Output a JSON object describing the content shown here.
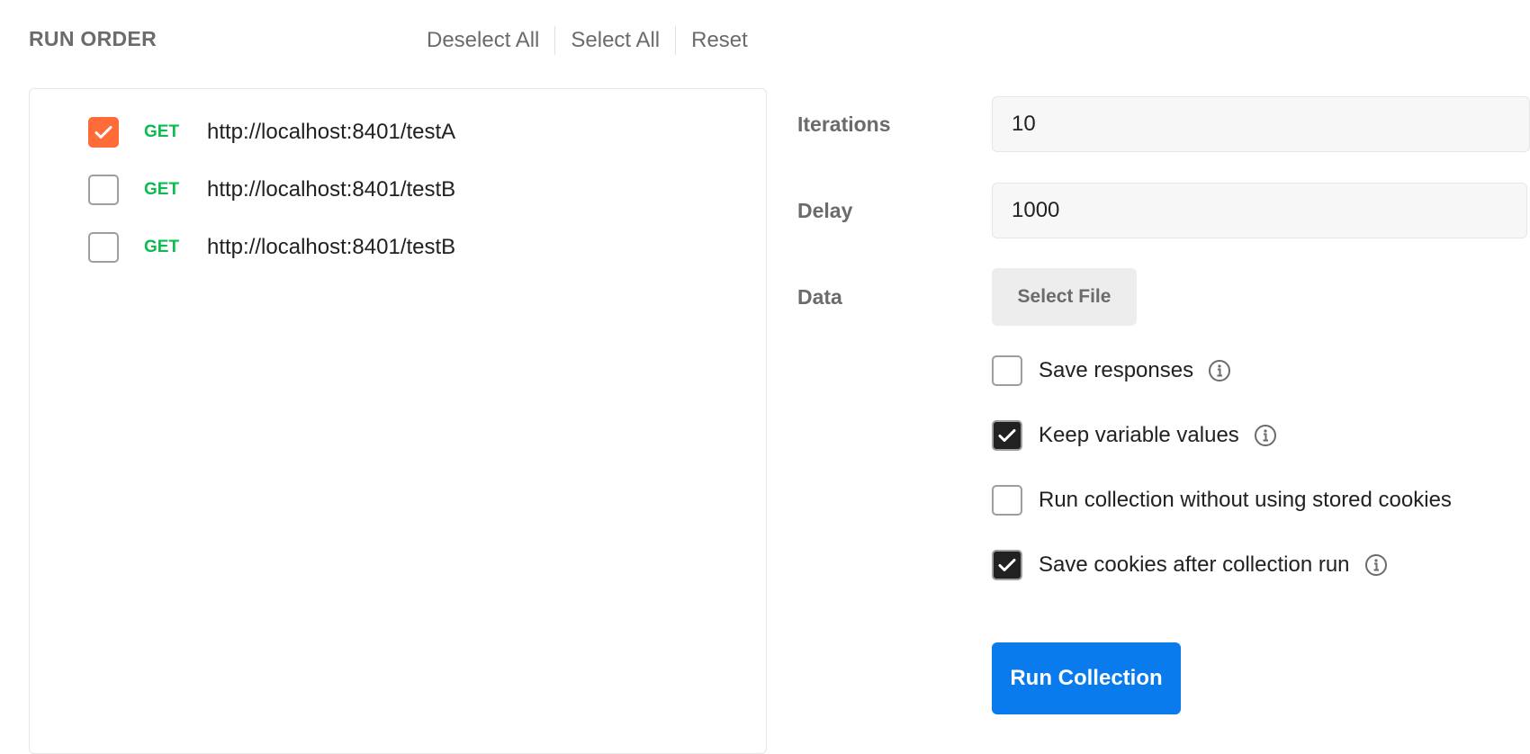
{
  "run_order": {
    "title": "RUN ORDER",
    "deselect_all": "Deselect All",
    "select_all": "Select All",
    "reset": "Reset",
    "requests": [
      {
        "method": "GET",
        "url": "http://localhost:8401/testA",
        "checked": true
      },
      {
        "method": "GET",
        "url": "http://localhost:8401/testB",
        "checked": false
      },
      {
        "method": "GET",
        "url": "http://localhost:8401/testB",
        "checked": false
      }
    ]
  },
  "settings": {
    "iterations_label": "Iterations",
    "iterations_value": "10",
    "delay_label": "Delay",
    "delay_value": "1000",
    "data_label": "Data",
    "select_file_label": "Select File",
    "options": [
      {
        "label": "Save responses",
        "checked": false,
        "info": true
      },
      {
        "label": "Keep variable values",
        "checked": true,
        "info": true
      },
      {
        "label": "Run collection without using stored cookies",
        "checked": false,
        "info": false
      },
      {
        "label": "Save cookies after collection run",
        "checked": true,
        "info": true
      }
    ],
    "run_button_label": "Run Collection"
  },
  "colors": {
    "accent_orange": "#ff6c37",
    "method_get_green": "#0cbb52",
    "primary_blue": "#097bed",
    "checkbox_dark": "#212121"
  }
}
